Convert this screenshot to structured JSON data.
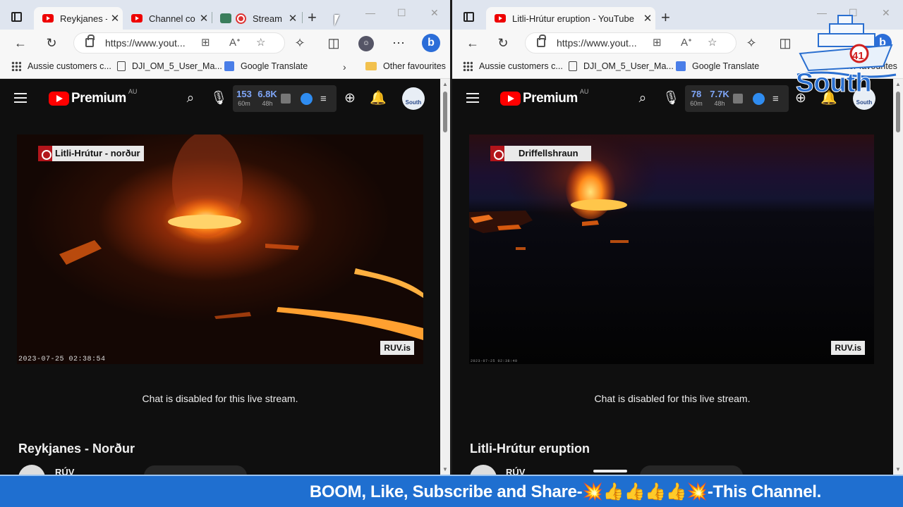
{
  "left_window": {
    "tabs": [
      {
        "title": "Reykjanes - ",
        "icon": "youtube-icon"
      },
      {
        "title": "Channel co",
        "icon": "youtube-icon"
      },
      {
        "title": "Stream",
        "icon": "record-icon"
      }
    ],
    "url": "https://www.yout...",
    "bookmarks": [
      "Aussie customers c...",
      "DJI_OM_5_User_Ma...",
      "Google Translate",
      "Other favourites"
    ],
    "youtube": {
      "logo": "Premium",
      "region": "AU",
      "stats": {
        "viewers": "153",
        "viewers_label": "60m",
        "total": "6.8K",
        "total_label": "48h"
      },
      "avatar_text": "South",
      "video": {
        "badge": "Litli-Hrútur - norður",
        "watermark": "RUV.is",
        "timestamp": "2023-07-25 02:38:54"
      },
      "chat_note": "Chat is disabled for this live stream.",
      "title": "Reykjanes - Norður",
      "channel": "RÚV"
    }
  },
  "right_window": {
    "tabs": [
      {
        "title": "Litli-Hrútur eruption - YouTube",
        "icon": "youtube-icon"
      }
    ],
    "url": "https://www.yout...",
    "bookmarks": [
      "Aussie customers c...",
      "DJI_OM_5_User_Ma...",
      "Google Translate",
      "Other favourites"
    ],
    "youtube": {
      "logo": "Premium",
      "region": "AU",
      "stats": {
        "viewers": "78",
        "viewers_label": "60m",
        "total": "7.7K",
        "total_label": "48h"
      },
      "avatar_text": "South",
      "video": {
        "badge": "Driffellshraun",
        "watermark": "RUV.is",
        "timestamp": "2023-07-25 02:38:40"
      },
      "chat_note": "Chat is disabled for this live stream.",
      "title": "Litli-Hrútur eruption",
      "channel": "RÚV"
    }
  },
  "overlay": {
    "banner": "BOOM, Like, Subscribe and Share-💥👍👍👍👍💥-This Channel.",
    "logo_number": "41",
    "logo_word": "South"
  },
  "colors": {
    "youtube_red": "#ff0000",
    "banner_blue": "#1f6fd0",
    "stat_blue": "#7fa6f8",
    "ruv_red": "#b3151b"
  }
}
